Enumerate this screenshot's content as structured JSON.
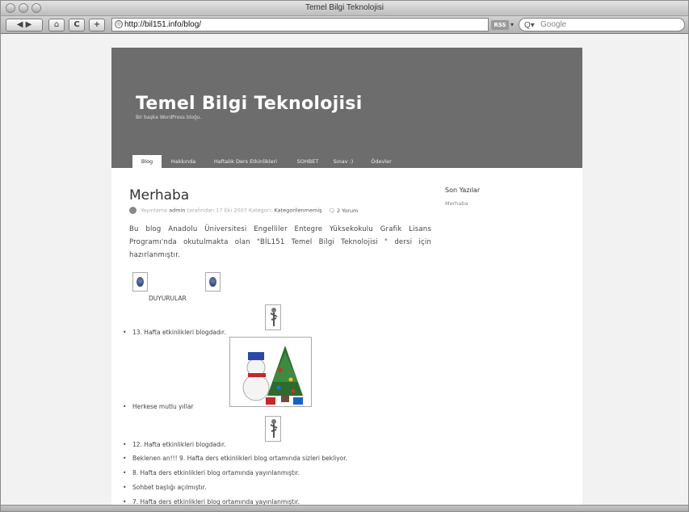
{
  "window": {
    "title": "Temel Bilgi Teknolojisi"
  },
  "toolbar": {
    "back_label": "◀ ▶",
    "home_label": "⌂",
    "reload_label": "C",
    "add_label": "+",
    "url": "http://bil151.info/blog/",
    "rss_label": "RSS",
    "search_placeholder": "Google"
  },
  "blog": {
    "title": "Temel Bilgi Teknolojisi",
    "description": "Bir başka WordPress bloğu.",
    "nav": [
      "Blog",
      "Hakkında",
      "Haftalık Ders Etkinlikleri",
      "SOHBET",
      "Sınav :)",
      "Ödevler"
    ]
  },
  "post": {
    "title": "Merhaba",
    "meta": {
      "prefix": "Yayınlama",
      "author": "admin",
      "date_text": "tarafından 17 Eki 2007 Kategori:",
      "category": "Kategorilenmemiş",
      "comments": "2 Yorum"
    },
    "body": "Bu blog Anadolu Üniversitesi Engelliler Entegre Yüksekokulu Grafik Lisans Programı'nda okutulmakta olan \"BİL151 Temel Bilgi Teknolojisi \" dersi için hazırlanmıştır.",
    "announcements_label": "DUYURULAR",
    "items": [
      "13. Hafta etkinlikleri blogdadır.",
      "Herkese mutlu yıllar",
      "12. Hafta etkinlikleri blogdadır.",
      "Beklenen an!!! 9. Hafta ders etkinlikleri blog ortamında sizleri bekliyor.",
      "8. Hafta ders etkinlikleri blog ortamında yayınlanmıştır.",
      "Sohbet başlığı açılmıştır.",
      "7. Hafta ders etkinlikleri blog ortamında yayınlanmıştır."
    ]
  },
  "sidebar": {
    "heading": "Son Yazılar",
    "links": [
      "Merhaba"
    ]
  }
}
